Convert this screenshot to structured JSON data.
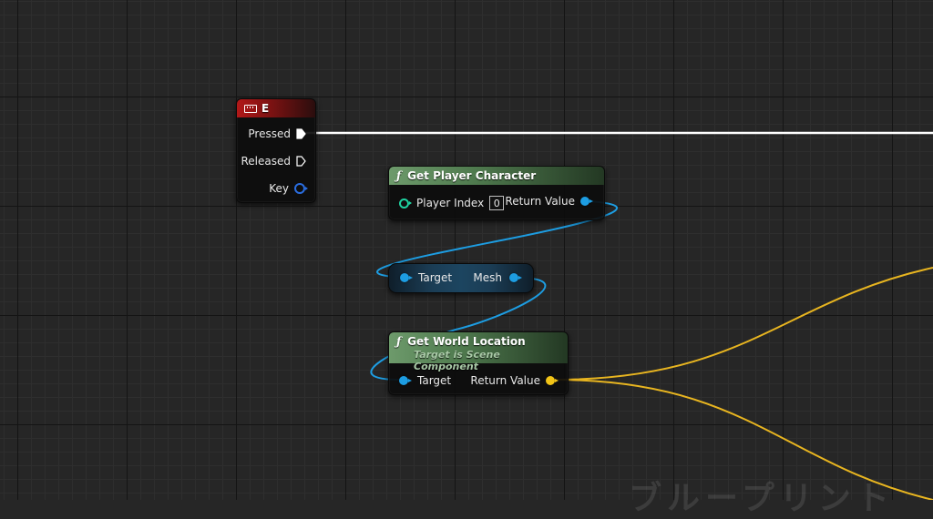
{
  "watermark_text": "ブループリント",
  "colors": {
    "exec_wire": "#ffffff",
    "object_wire": "#1d9de2",
    "vector_wire": "#e8b520",
    "event_header": "#b21818",
    "function_header": "#6d9a6b"
  },
  "event_node": {
    "title": "E",
    "icon": "keyboard-icon",
    "pins": {
      "pressed": "Pressed",
      "released": "Released",
      "key": "Key"
    }
  },
  "get_player_character": {
    "title": "Get Player Character",
    "icon": "function-icon",
    "player_index_label": "Player Index",
    "player_index_value": "0",
    "return_label": "Return Value"
  },
  "mesh_node": {
    "target_label": "Target",
    "mesh_label": "Mesh"
  },
  "get_world_location": {
    "title": "Get World Location",
    "subtitle": "Target is Scene Component",
    "icon": "function-icon",
    "target_label": "Target",
    "return_label": "Return Value"
  }
}
